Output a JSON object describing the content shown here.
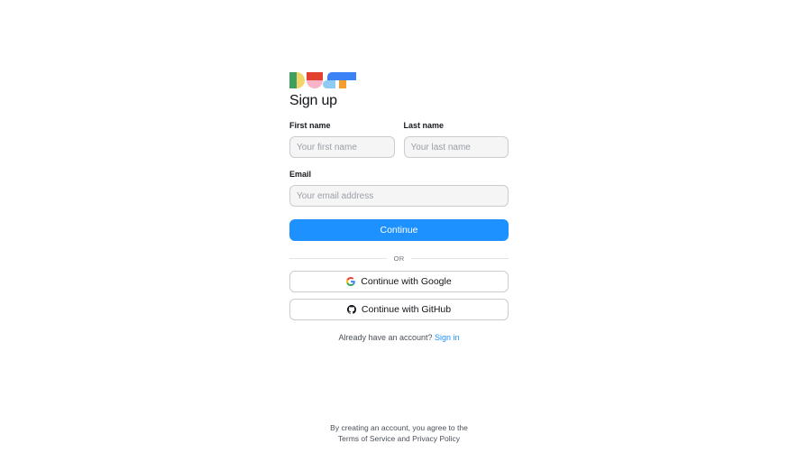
{
  "page": {
    "title": "Sign up"
  },
  "logo": {
    "alt": "Dust logo"
  },
  "form": {
    "first_name": {
      "label": "First name",
      "placeholder": "Your first name"
    },
    "last_name": {
      "label": "Last name",
      "placeholder": "Your last name"
    },
    "email": {
      "label": "Email",
      "placeholder": "Your email address"
    },
    "continue_label": "Continue"
  },
  "divider": {
    "text": "OR"
  },
  "oauth": {
    "google_label": "Continue with Google",
    "github_label": "Continue with GitHub"
  },
  "signin": {
    "prompt": "Already have an account?",
    "link_label": "Sign in"
  },
  "footer": {
    "line1": "By creating an account, you agree to the",
    "terms_label": "Terms of Service",
    "and_text": "and",
    "privacy_label": "Privacy Policy"
  },
  "colors": {
    "accent": "#1c91ff",
    "border": "#c9ccd1",
    "input_bg": "#f5f5f6"
  },
  "icons": {
    "google": "google-icon",
    "github": "github-icon"
  }
}
